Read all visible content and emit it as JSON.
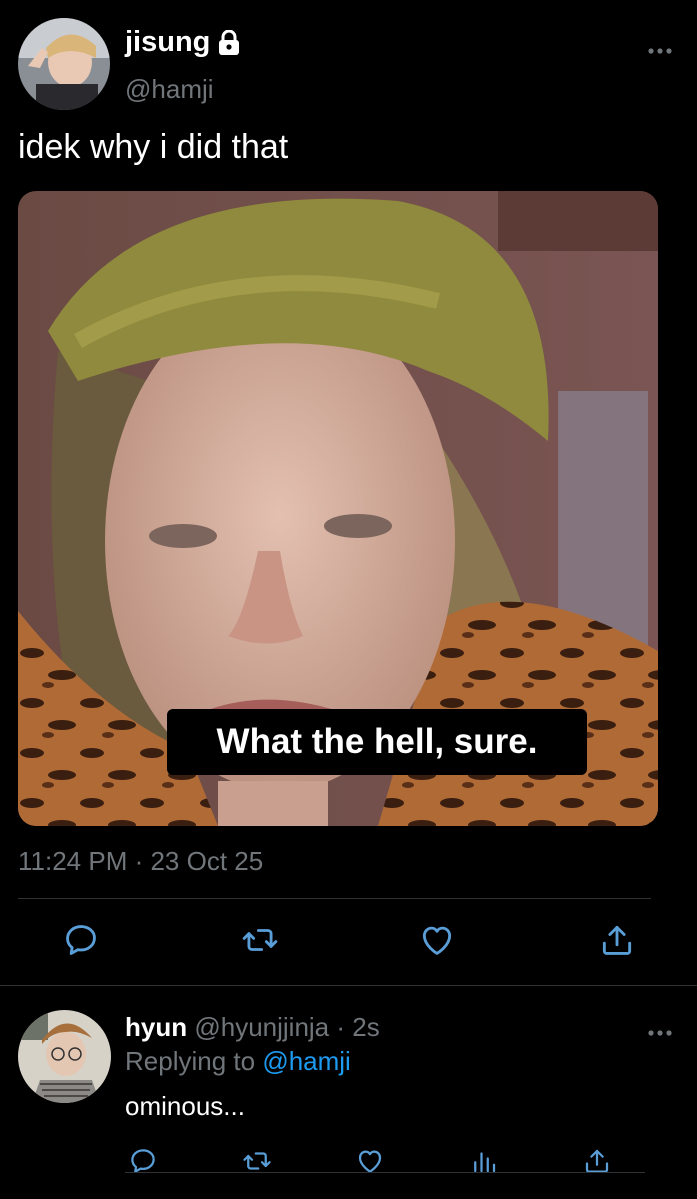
{
  "tweet": {
    "display_name": "jisung",
    "handle": "@hamji",
    "text": "idek why i did that",
    "media_caption": "What the hell, sure.",
    "timestamp": "11:24 PM · 23 Oct 25",
    "protected": true
  },
  "reply": {
    "display_name": "hyun",
    "handle": "@hyunjjinja",
    "separator": " · ",
    "time": "2s",
    "replying_prefix": "Replying to ",
    "replying_to": "@hamji",
    "text": "ominous..."
  },
  "icons": {
    "reply": "reply-icon",
    "retweet": "retweet-icon",
    "like": "heart-icon",
    "share": "share-icon",
    "analytics": "analytics-icon",
    "more": "more-icon",
    "lock": "lock-icon"
  },
  "colors": {
    "background": "#000000",
    "text": "#ffffff",
    "secondary_text": "#71767b",
    "accent": "#1d9bf0",
    "icon": "#5a9ed8"
  }
}
